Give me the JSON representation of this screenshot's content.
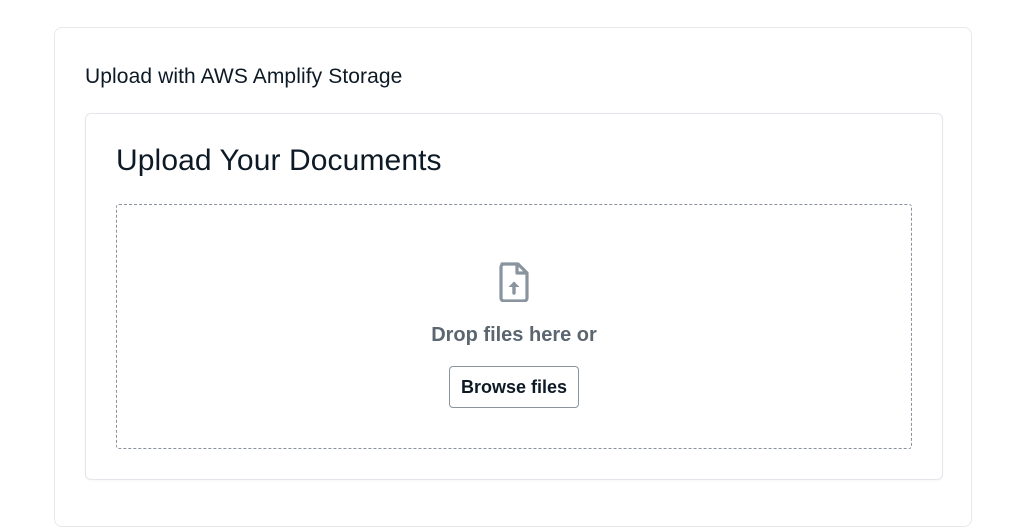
{
  "section": {
    "title": "Upload with AWS Amplify Storage"
  },
  "uploader": {
    "heading": "Upload Your Documents",
    "drop_text": "Drop files here or",
    "browse_label": "Browse files",
    "icon": "file-upload-icon"
  },
  "colors": {
    "text_primary": "#0d1a26",
    "text_secondary": "#5c6670",
    "icon": "#89949f",
    "border": "#e6e9ec",
    "dropzone_border": "#8a939c"
  }
}
